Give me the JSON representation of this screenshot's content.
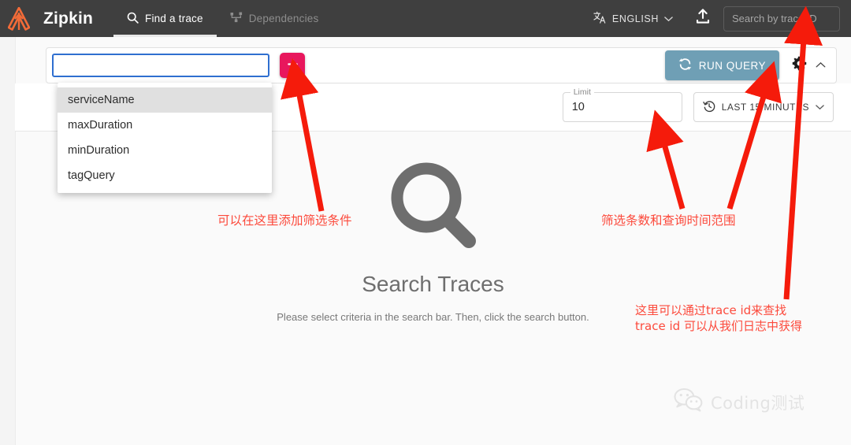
{
  "navbar": {
    "brand": "Zipkin",
    "logo_icon": "zipkin-logo-icon",
    "logo_color": "#f26b38",
    "background": "#3f3f3f",
    "tabs": [
      {
        "label": "Find a trace",
        "icon": "search-icon",
        "active": true
      },
      {
        "label": "Dependencies",
        "icon": "dependency-tree-icon",
        "active": false
      }
    ],
    "language": {
      "label": "ENGLISH",
      "icon": "translate-icon",
      "chevron": "chevron-down-icon"
    },
    "upload": {
      "icon": "upload-icon"
    },
    "trace_search": {
      "placeholder": "Search by trace ID",
      "value": ""
    }
  },
  "searchbar": {
    "criteria_input": {
      "value": "",
      "placeholder": ""
    },
    "add_button": {
      "label": "+",
      "color": "#e8175d",
      "icon": "plus-icon"
    },
    "run_query": {
      "label": "RUN QUERY",
      "icon": "sync-refresh-icon",
      "color": "#6f9fb5"
    },
    "settings": {
      "icon": "gear-icon"
    },
    "collapse": {
      "icon": "chevron-up-icon"
    }
  },
  "dropdown": {
    "items": [
      {
        "label": "serviceName",
        "selected": true
      },
      {
        "label": "maxDuration",
        "selected": false
      },
      {
        "label": "minDuration",
        "selected": false
      },
      {
        "label": "tagQuery",
        "selected": false
      }
    ]
  },
  "options": {
    "limit": {
      "label": "Limit",
      "value": "10"
    },
    "time_range": {
      "label": "LAST 15 MINUTES",
      "icon": "history-clock-icon",
      "chevron": "chevron-down-icon"
    }
  },
  "empty_state": {
    "icon": "magnifier-icon",
    "title": "Search Traces",
    "subtitle": "Please select criteria in the search bar. Then, click the search button."
  },
  "annotations": {
    "color": "#fc4a3c",
    "filter": "可以在这里添加筛选条件",
    "limit": "筛选条数和查询时间范围",
    "traceid_line1": "这里可以通过trace id来查找",
    "traceid_line2": "trace id 可以从我们日志中获得"
  },
  "watermark": {
    "icon": "wechat-icon",
    "text": "Coding测试"
  }
}
